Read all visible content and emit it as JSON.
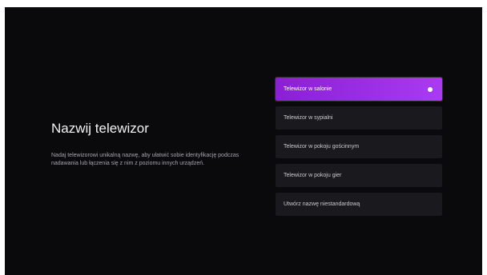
{
  "page": {
    "title": "Nazwij telewizor",
    "description": "Nadaj telewizorowi unikalną nazwę, aby ułatwić sobie identyfikację podczas nadawania lub łączenia się z nim z poziomu innych urządzeń."
  },
  "options": [
    {
      "label": "Telewizor w salonie",
      "selected": true
    },
    {
      "label": "Telewizor w sypialni",
      "selected": false
    },
    {
      "label": "Telewizor w pokoju gościnnym",
      "selected": false
    },
    {
      "label": "Telewizor w pokoju gier",
      "selected": false
    },
    {
      "label": "Utwórz nazwę niestandardową",
      "selected": false
    }
  ],
  "colors": {
    "accent_start": "#8a1fd4",
    "accent_end": "#a93bf2",
    "background": "#0a0a0c"
  }
}
